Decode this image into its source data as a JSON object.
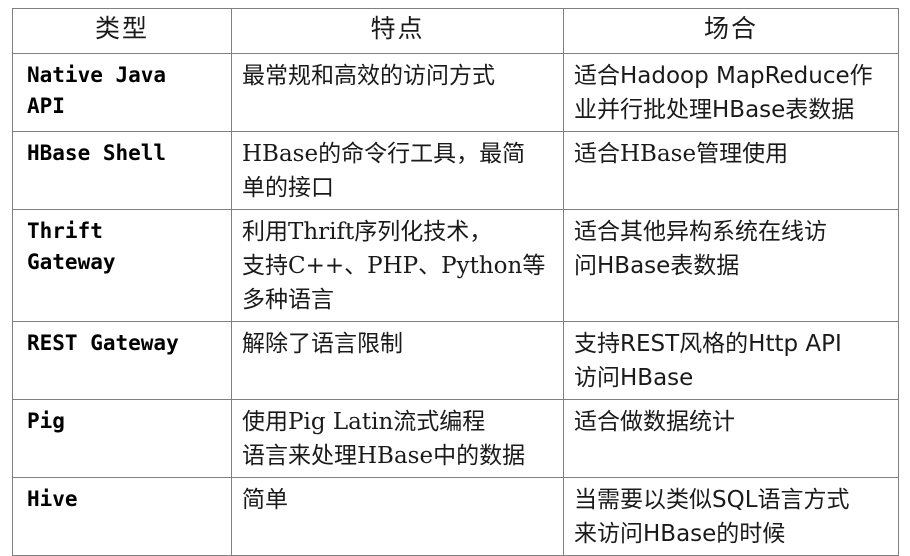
{
  "table": {
    "columns": [
      "类型",
      "特点",
      "场合"
    ],
    "rows": [
      {
        "type": "Native Java API",
        "type_lines": [
          "Native Java",
          "API"
        ],
        "feature": "最常规和高效的访问方式",
        "feature_lines": [
          "最常规和高效的访问方式"
        ],
        "scene": "适合Hadoop MapReduce作业并行批处理HBase表数据",
        "scene_lines": [
          "适合Hadoop MapReduce作",
          "业并行批处理HBase表数据"
        ]
      },
      {
        "type": "HBase Shell",
        "type_lines": [
          "HBase Shell"
        ],
        "feature": "HBase的命令行工具，最简单的接口",
        "feature_lines": [
          "HBase的命令行工具，最简",
          "单的接口"
        ],
        "scene": "适合HBase管理使用",
        "scene_lines": [
          "适合HBase管理使用"
        ]
      },
      {
        "type": "Thrift Gateway",
        "type_lines": [
          "Thrift",
          "Gateway"
        ],
        "feature": "利用Thrift序列化技术，支持C++、PHP、Python等多种语言",
        "feature_lines": [
          "利用Thrift序列化技术，",
          "支持C++、PHP、Python等",
          "多种语言"
        ],
        "scene": "适合其他异构系统在线访问HBase表数据",
        "scene_lines": [
          "适合其他异构系统在线访",
          "问HBase表数据"
        ]
      },
      {
        "type": "REST Gateway",
        "type_lines": [
          "REST Gateway"
        ],
        "feature": "解除了语言限制",
        "feature_lines": [
          "解除了语言限制"
        ],
        "scene": "支持REST风格的Http API访问HBase",
        "scene_lines": [
          "支持REST风格的Http API",
          "访问HBase"
        ]
      },
      {
        "type": "Pig",
        "type_lines": [
          "Pig"
        ],
        "feature": "使用Pig Latin流式编程语言来处理HBase中的数据",
        "feature_lines": [
          "使用Pig Latin流式编程",
          "语言来处理HBase中的数据"
        ],
        "scene": "适合做数据统计",
        "scene_lines": [
          "适合做数据统计"
        ]
      },
      {
        "type": "Hive",
        "type_lines": [
          "Hive"
        ],
        "feature": "简单",
        "feature_lines": [
          "简单"
        ],
        "scene": "当需要以类似SQL语言方式来访问HBase的时候",
        "scene_lines": [
          "当需要以类似SQL语言方式",
          "来访问HBase的时候"
        ]
      }
    ]
  },
  "style": {
    "border_color": "#808080",
    "text_color": "#1a1a1a",
    "background": "#ffffff"
  }
}
